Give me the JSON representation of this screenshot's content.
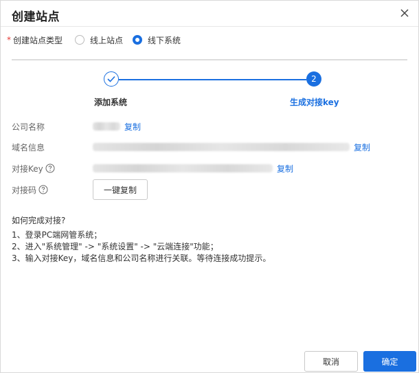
{
  "dialog": {
    "title": "创建站点",
    "close_icon": "close-icon"
  },
  "site_type": {
    "required_mark": "*",
    "label": "创建站点类型",
    "options": [
      {
        "label": "线上站点",
        "checked": false
      },
      {
        "label": "线下系统",
        "checked": true
      }
    ]
  },
  "stepper": {
    "steps": [
      {
        "label": "添加系统",
        "state": "completed",
        "icon": "check-icon"
      },
      {
        "label": "生成对接key",
        "state": "active",
        "number": "2"
      }
    ]
  },
  "fields": {
    "company_name": {
      "label": "公司名称",
      "copy_label": "复制",
      "value_hidden": true
    },
    "domain_info": {
      "label": "域名信息",
      "copy_label": "复制",
      "value_hidden": true
    },
    "dock_key": {
      "label": "对接Key",
      "help_icon": "question-circle-icon",
      "copy_label": "复制",
      "value_hidden": true
    },
    "dock_code": {
      "label": "对接码",
      "help_icon": "question-circle-icon",
      "button_label": "一键复制"
    }
  },
  "howto": {
    "title": "如何完成对接?",
    "steps": [
      "1、登录PC端网管系统；",
      "2、进入\"系统管理\" -> \"系统设置\" -> \"云端连接\"功能；",
      "3、输入对接Key，域名信息和公司名称进行关联。等待连接成功提示。"
    ]
  },
  "footer": {
    "cancel_label": "取消",
    "ok_label": "确定"
  },
  "colors": {
    "primary": "#1a6fe0",
    "required": "#e53935"
  }
}
